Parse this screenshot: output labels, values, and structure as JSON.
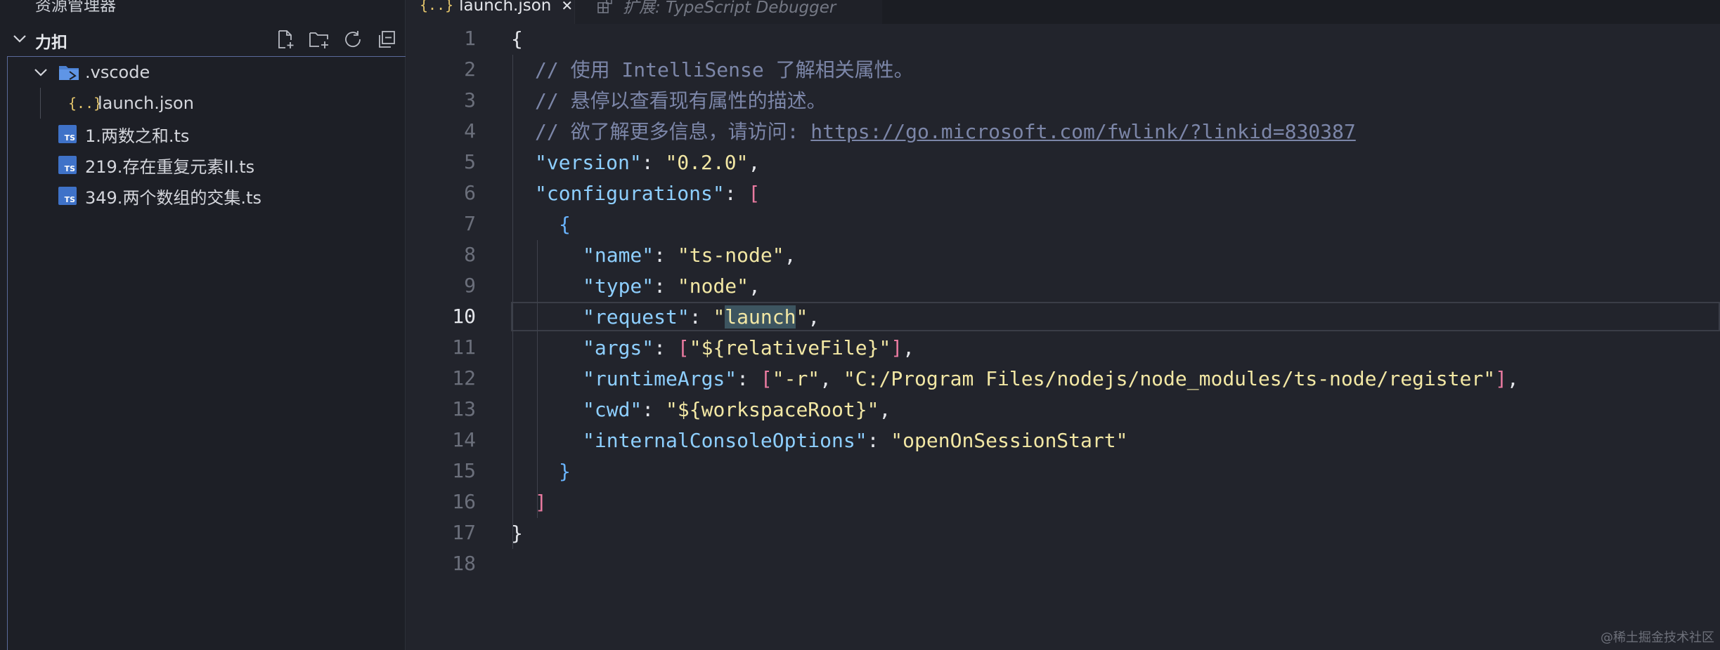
{
  "explorer": {
    "title": "资源管理器",
    "more": "···",
    "section_title": "力扣"
  },
  "tree": {
    "items": [
      {
        "label": ".vscode",
        "kind": "folder",
        "icon": "vscode-folder-icon"
      },
      {
        "label": "launch.json",
        "kind": "file",
        "icon": "json-icon"
      },
      {
        "label": "1.两数之和.ts",
        "kind": "file",
        "icon": "ts-file-icon"
      },
      {
        "label": "219.存在重复元素II.ts",
        "kind": "file",
        "icon": "ts-file-icon"
      },
      {
        "label": "349.两个数组的交集.ts",
        "kind": "file",
        "icon": "ts-file-icon"
      }
    ],
    "json_glyph": "{..}",
    "ts_badge": "TS"
  },
  "tabs": {
    "active_label": "launch.json",
    "close_glyph": "✕",
    "inactive_label": "扩展: TypeScript Debugger"
  },
  "editor": {
    "active_line": 10,
    "line_numbers": [
      "1",
      "2",
      "3",
      "4",
      "5",
      "6",
      "7",
      "8",
      "9",
      "10",
      "11",
      "12",
      "13",
      "14",
      "15",
      "16",
      "17",
      "18"
    ],
    "lines": {
      "l1": "{",
      "l2": "// 使用 IntelliSense 了解相关属性。",
      "l3": "// 悬停以查看现有属性的描述。",
      "l4_prefix": "// 欲了解更多信息，请访问: ",
      "l4_link": "https://go.microsoft.com/fwlink/?linkid=830387",
      "l5_key": "\"version\"",
      "l5_val": "\"0.2.0\"",
      "l6_key": "\"configurations\"",
      "l7": "{",
      "l8_key": "\"name\"",
      "l8_val": "\"ts-node\"",
      "l9_key": "\"type\"",
      "l9_val": "\"node\"",
      "l10_key": "\"request\"",
      "l10_val_word": "launch",
      "l11_key": "\"args\"",
      "l11_val": "\"${relativeFile}\"",
      "l12_key": "\"runtimeArgs\"",
      "l12_val1": "\"-r\"",
      "l12_val2": "\"C:/Program Files/nodejs/node_modules/ts-node/register\"",
      "l13_key": "\"cwd\"",
      "l13_val": "\"${workspaceRoot}\"",
      "l14_key": "\"internalConsoleOptions\"",
      "l14_val": "\"openOnSessionStart\"",
      "l15": "}",
      "l16": "]",
      "l17": "}"
    }
  },
  "watermark": "@稀土掘金技术社区",
  "colors": {
    "background": "#22242c",
    "sidebar": "#1d1f26",
    "comment": "#7c86a8",
    "key": "#8ecfff",
    "string": "#f2e7a4",
    "bracket_pink": "#e97aa0",
    "bracket_blue": "#69b4ff",
    "ts_badge": "#3f72c8",
    "json_icon": "#e3c46b"
  }
}
